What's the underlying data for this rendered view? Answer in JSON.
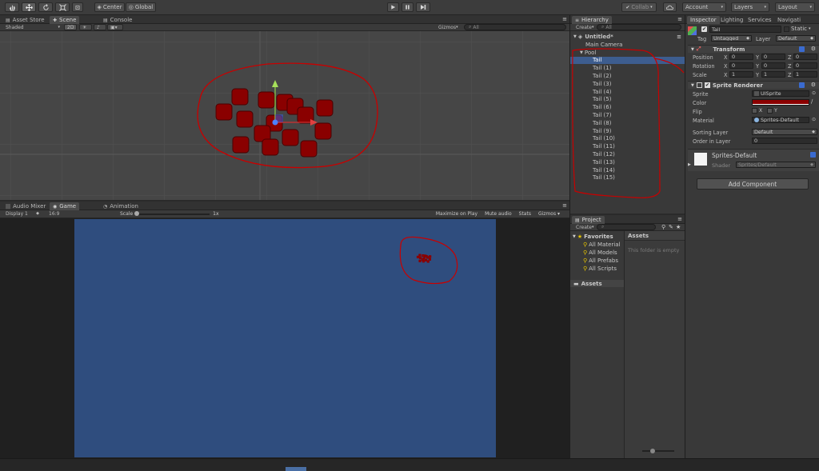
{
  "toolbar": {
    "center_label": "Center",
    "global_label": "Global",
    "collab_label": "Collab",
    "account_label": "Account",
    "layers_label": "Layers",
    "layout_label": "Layout"
  },
  "scene_panel": {
    "tabs": [
      "Asset Store",
      "Scene",
      "Console"
    ],
    "shading": "Shaded",
    "mode_2d": "2D",
    "gizmos_label": "Gizmos",
    "search_placeholder": "All"
  },
  "game_panel": {
    "tabs": [
      "Audio Mixer",
      "Game",
      "Animation"
    ],
    "display": "Display 1",
    "aspect": "16:9",
    "scale_label": "Scale",
    "scale_value": "1x",
    "maximize_label": "Maximize on Play",
    "mute_label": "Mute audio",
    "stats_label": "Stats",
    "gizmos_label": "Gizmos",
    "background_color": "#2f4d7e"
  },
  "hierarchy": {
    "tab": "Hierarchy",
    "create_label": "Create",
    "search_placeholder": "All",
    "scene_name": "Untitled*",
    "items": [
      "Main Camera",
      "Pool",
      "Tail",
      "Tail (1)",
      "Tail (2)",
      "Tail (3)",
      "Tail (4)",
      "Tail (5)",
      "Tail (6)",
      "Tail (7)",
      "Tail (8)",
      "Tail (9)",
      "Tail (10)",
      "Tail (11)",
      "Tail (12)",
      "Tail (13)",
      "Tail (14)",
      "Tail (15)"
    ]
  },
  "project": {
    "tab": "Project",
    "create_label": "Create",
    "favorites_label": "Favorites",
    "favorites": [
      "All Material",
      "All Models",
      "All Prefabs",
      "All Scripts"
    ],
    "assets_label": "Assets",
    "assets_header": "Assets",
    "empty_message": "This folder is empty"
  },
  "inspector": {
    "tabs": [
      "Inspector",
      "Lighting",
      "Services",
      "Navigati"
    ],
    "object_name": "Tail",
    "static_label": "Static",
    "tag_label": "Tag",
    "tag_value": "Untagged",
    "layer_label": "Layer",
    "layer_value": "Default",
    "transform": {
      "title": "Transform",
      "position_label": "Position",
      "rotation_label": "Rotation",
      "scale_label": "Scale",
      "position": [
        "0",
        "0",
        "0"
      ],
      "rotation": [
        "0",
        "0",
        "0"
      ],
      "scale": [
        "1",
        "1",
        "1"
      ],
      "axes": [
        "X",
        "Y",
        "Z"
      ]
    },
    "sprite_renderer": {
      "title": "Sprite Renderer",
      "sprite_label": "Sprite",
      "sprite_value": "UISprite",
      "color_label": "Color",
      "color_value": "#8b0000",
      "flip_label": "Flip",
      "flip_x": "X",
      "flip_y": "Y",
      "material_label": "Material",
      "material_value": "Sprites-Default",
      "sorting_layer_label": "Sorting Layer",
      "sorting_layer_value": "Default",
      "order_label": "Order in Layer",
      "order_value": "0"
    },
    "material_section": {
      "name": "Sprites-Default",
      "shader_label": "Shader",
      "shader_value": "Sprites/Default"
    },
    "add_component_label": "Add Component"
  },
  "colors": {
    "annotation_red": "#c80000",
    "tail_red": "#8a0000",
    "selection_blue": "#3d5d8f"
  },
  "icons": [
    "hand-icon",
    "move-icon",
    "rotate-icon",
    "scale-icon",
    "rect-icon",
    "play-icon",
    "pause-icon",
    "step-icon",
    "cloud-icon",
    "lock-icon",
    "menu-icon",
    "audio-icon",
    "effects-icon",
    "gear-icon",
    "help-icon",
    "folder-icon",
    "star-icon",
    "search-icon"
  ]
}
